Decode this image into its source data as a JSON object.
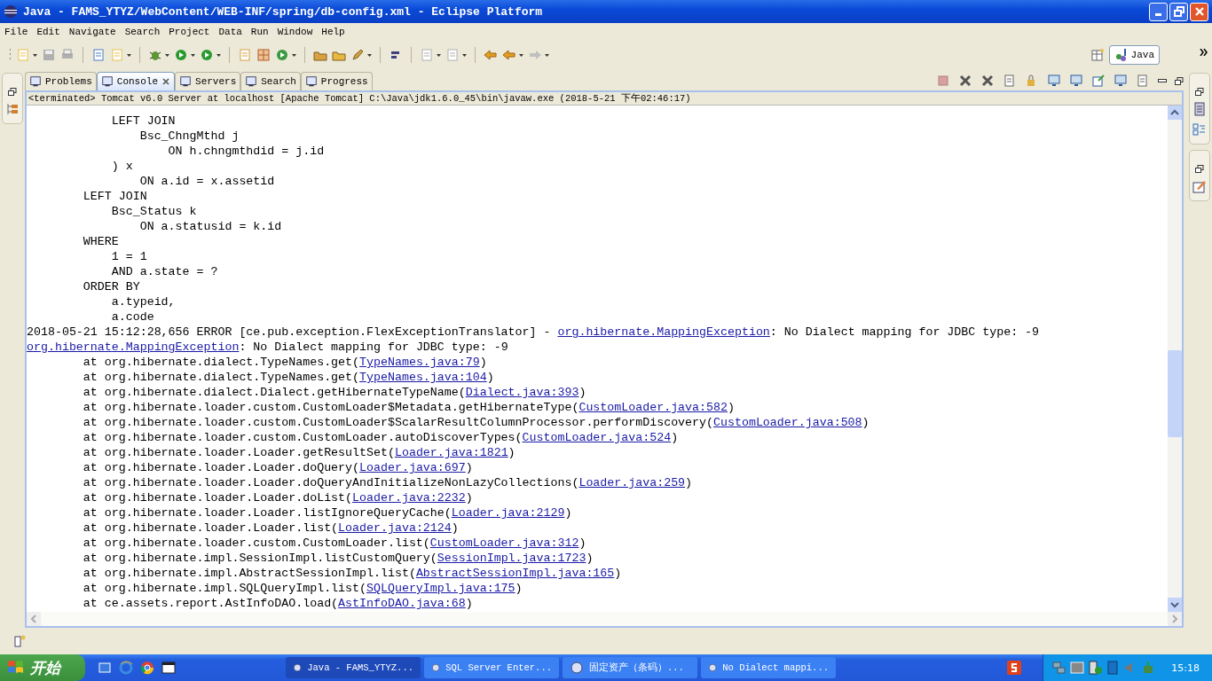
{
  "window": {
    "title": "Java - FAMS_YTYZ/WebContent/WEB-INF/spring/db-config.xml - Eclipse Platform"
  },
  "menu": [
    "File",
    "Edit",
    "Navigate",
    "Search",
    "Project",
    "Data",
    "Run",
    "Window",
    "Help"
  ],
  "perspective": {
    "label": "Java",
    "selected": true
  },
  "tabs": [
    {
      "label": "Problems",
      "selected": false
    },
    {
      "label": "Console",
      "selected": true
    },
    {
      "label": "Servers",
      "selected": false
    },
    {
      "label": "Search",
      "selected": false
    },
    {
      "label": "Progress",
      "selected": false
    }
  ],
  "console": {
    "header": "<terminated> Tomcat v6.0 Server at localhost [Apache Tomcat] C:\\Java\\jdk1.6.0_45\\bin\\javaw.exe (2018-5-21 下午02:46:17)",
    "lines": [
      {
        "parts": [
          {
            "kind": "plain",
            "text": "            LEFT JOIN"
          }
        ]
      },
      {
        "parts": [
          {
            "kind": "plain",
            "text": "                Bsc_ChngMthd j"
          }
        ]
      },
      {
        "parts": [
          {
            "kind": "plain",
            "text": "                    ON h.chngmthdid = j.id"
          }
        ]
      },
      {
        "parts": [
          {
            "kind": "plain",
            "text": "            ) x"
          }
        ]
      },
      {
        "parts": [
          {
            "kind": "plain",
            "text": "                ON a.id = x.assetid"
          }
        ]
      },
      {
        "parts": [
          {
            "kind": "plain",
            "text": "        LEFT JOIN"
          }
        ]
      },
      {
        "parts": [
          {
            "kind": "plain",
            "text": "            Bsc_Status k"
          }
        ]
      },
      {
        "parts": [
          {
            "kind": "plain",
            "text": "                ON a.statusid = k.id"
          }
        ]
      },
      {
        "parts": [
          {
            "kind": "plain",
            "text": "        WHERE"
          }
        ]
      },
      {
        "parts": [
          {
            "kind": "plain",
            "text": "            1 = 1"
          }
        ]
      },
      {
        "parts": [
          {
            "kind": "plain",
            "text": "            AND a.state = ?"
          }
        ]
      },
      {
        "parts": [
          {
            "kind": "plain",
            "text": "        ORDER BY"
          }
        ]
      },
      {
        "parts": [
          {
            "kind": "plain",
            "text": "            a.typeid,"
          }
        ]
      },
      {
        "parts": [
          {
            "kind": "plain",
            "text": "            a.code"
          }
        ]
      },
      {
        "parts": [
          {
            "kind": "plain",
            "text": "2018-05-21 15:12:28,656 ERROR [ce.pub.exception.FlexExceptionTranslator] - "
          },
          {
            "kind": "link",
            "text": "org.hibernate.MappingException"
          },
          {
            "kind": "plain",
            "text": ": No Dialect mapping for JDBC type: -9"
          }
        ]
      },
      {
        "parts": [
          {
            "kind": "link",
            "text": "org.hibernate.MappingException"
          },
          {
            "kind": "plain",
            "text": ": No Dialect mapping for JDBC type: -9"
          }
        ]
      },
      {
        "parts": [
          {
            "kind": "plain",
            "text": "        at org.hibernate.dialect.TypeNames.get("
          },
          {
            "kind": "link",
            "text": "TypeNames.java:79"
          },
          {
            "kind": "plain",
            "text": ")"
          }
        ]
      },
      {
        "parts": [
          {
            "kind": "plain",
            "text": "        at org.hibernate.dialect.TypeNames.get("
          },
          {
            "kind": "link",
            "text": "TypeNames.java:104"
          },
          {
            "kind": "plain",
            "text": ")"
          }
        ]
      },
      {
        "parts": [
          {
            "kind": "plain",
            "text": "        at org.hibernate.dialect.Dialect.getHibernateTypeName("
          },
          {
            "kind": "link",
            "text": "Dialect.java:393"
          },
          {
            "kind": "plain",
            "text": ")"
          }
        ]
      },
      {
        "parts": [
          {
            "kind": "plain",
            "text": "        at org.hibernate.loader.custom.CustomLoader$Metadata.getHibernateType("
          },
          {
            "kind": "link",
            "text": "CustomLoader.java:582"
          },
          {
            "kind": "plain",
            "text": ")"
          }
        ]
      },
      {
        "parts": [
          {
            "kind": "plain",
            "text": "        at org.hibernate.loader.custom.CustomLoader$ScalarResultColumnProcessor.performDiscovery("
          },
          {
            "kind": "link",
            "text": "CustomLoader.java:508"
          },
          {
            "kind": "plain",
            "text": ")"
          }
        ]
      },
      {
        "parts": [
          {
            "kind": "plain",
            "text": "        at org.hibernate.loader.custom.CustomLoader.autoDiscoverTypes("
          },
          {
            "kind": "link",
            "text": "CustomLoader.java:524"
          },
          {
            "kind": "plain",
            "text": ")"
          }
        ]
      },
      {
        "parts": [
          {
            "kind": "plain",
            "text": "        at org.hibernate.loader.Loader.getResultSet("
          },
          {
            "kind": "link",
            "text": "Loader.java:1821"
          },
          {
            "kind": "plain",
            "text": ")"
          }
        ]
      },
      {
        "parts": [
          {
            "kind": "plain",
            "text": "        at org.hibernate.loader.Loader.doQuery("
          },
          {
            "kind": "link",
            "text": "Loader.java:697"
          },
          {
            "kind": "plain",
            "text": ")"
          }
        ]
      },
      {
        "parts": [
          {
            "kind": "plain",
            "text": "        at org.hibernate.loader.Loader.doQueryAndInitializeNonLazyCollections("
          },
          {
            "kind": "link",
            "text": "Loader.java:259"
          },
          {
            "kind": "plain",
            "text": ")"
          }
        ]
      },
      {
        "parts": [
          {
            "kind": "plain",
            "text": "        at org.hibernate.loader.Loader.doList("
          },
          {
            "kind": "link",
            "text": "Loader.java:2232"
          },
          {
            "kind": "plain",
            "text": ")"
          }
        ]
      },
      {
        "parts": [
          {
            "kind": "plain",
            "text": "        at org.hibernate.loader.Loader.listIgnoreQueryCache("
          },
          {
            "kind": "link",
            "text": "Loader.java:2129"
          },
          {
            "kind": "plain",
            "text": ")"
          }
        ]
      },
      {
        "parts": [
          {
            "kind": "plain",
            "text": "        at org.hibernate.loader.Loader.list("
          },
          {
            "kind": "link",
            "text": "Loader.java:2124"
          },
          {
            "kind": "plain",
            "text": ")"
          }
        ]
      },
      {
        "parts": [
          {
            "kind": "plain",
            "text": "        at org.hibernate.loader.custom.CustomLoader.list("
          },
          {
            "kind": "link",
            "text": "CustomLoader.java:312"
          },
          {
            "kind": "plain",
            "text": ")"
          }
        ]
      },
      {
        "parts": [
          {
            "kind": "plain",
            "text": "        at org.hibernate.impl.SessionImpl.listCustomQuery("
          },
          {
            "kind": "link",
            "text": "SessionImpl.java:1723"
          },
          {
            "kind": "plain",
            "text": ")"
          }
        ]
      },
      {
        "parts": [
          {
            "kind": "plain",
            "text": "        at org.hibernate.impl.AbstractSessionImpl.list("
          },
          {
            "kind": "link",
            "text": "AbstractSessionImpl.java:165"
          },
          {
            "kind": "plain",
            "text": ")"
          }
        ]
      },
      {
        "parts": [
          {
            "kind": "plain",
            "text": "        at org.hibernate.impl.SQLQueryImpl.list("
          },
          {
            "kind": "link",
            "text": "SQLQueryImpl.java:175"
          },
          {
            "kind": "plain",
            "text": ")"
          }
        ]
      },
      {
        "parts": [
          {
            "kind": "plain",
            "text": "        at ce.assets.report.AstInfoDAO.load("
          },
          {
            "kind": "link",
            "text": "AstInfoDAO.java:68"
          },
          {
            "kind": "plain",
            "text": ")"
          }
        ]
      }
    ]
  },
  "taskbar": {
    "start": "开始",
    "tasks": [
      {
        "label": "Java - FAMS_YTYZ...",
        "selected": true
      },
      {
        "label": "SQL Server Enter...",
        "selected": false
      },
      {
        "label": "固定资产（条码）...",
        "selected": false
      },
      {
        "label": "No Dialect mappi...",
        "selected": false
      }
    ],
    "clock": "15:18"
  }
}
